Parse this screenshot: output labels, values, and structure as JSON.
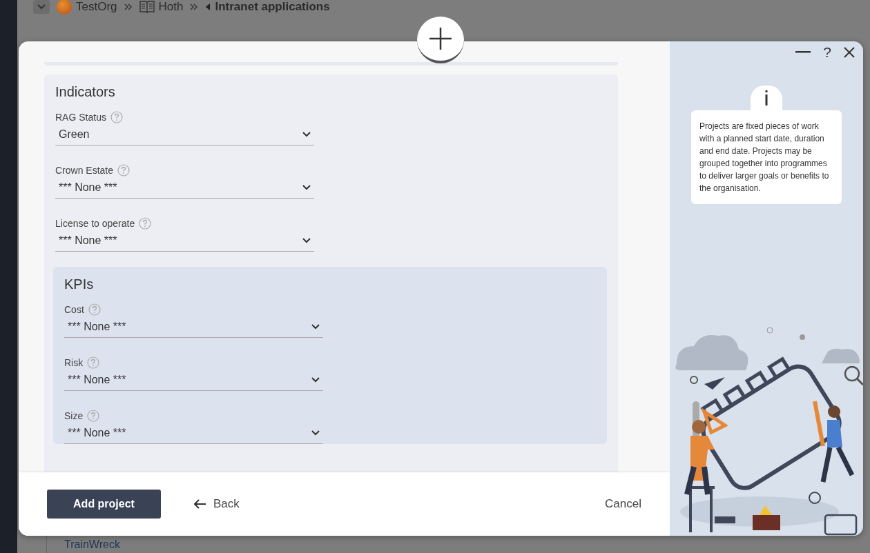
{
  "breadcrumb": [
    {
      "label": "TestOrg",
      "kind": "org"
    },
    {
      "label": "Hoth",
      "kind": "book"
    },
    {
      "label": "Intranet applications",
      "kind": "back"
    }
  ],
  "background_link": "TrainWreck",
  "modal": {
    "help_glyph": "?",
    "sections": [
      {
        "title": "Indicators",
        "fields": [
          {
            "label": "RAG Status",
            "value": "Green"
          },
          {
            "label": "Crown Estate",
            "value": "*** None ***"
          },
          {
            "label": "License to operate",
            "value": "*** None ***"
          }
        ],
        "subsections": [
          {
            "title": "KPIs",
            "fields": [
              {
                "label": "Cost",
                "value": "*** None ***"
              },
              {
                "label": "Risk",
                "value": "*** None ***"
              },
              {
                "label": "Size",
                "value": "*** None ***"
              }
            ]
          }
        ]
      }
    ],
    "info_text": "Projects are fixed pieces of work with a planned start date, duration and end date. Projects may be grouped together into programmes to deliver larger goals or benefits to the organisation.",
    "footer": {
      "primary": "Add project",
      "back": "Back",
      "cancel": "Cancel"
    }
  }
}
